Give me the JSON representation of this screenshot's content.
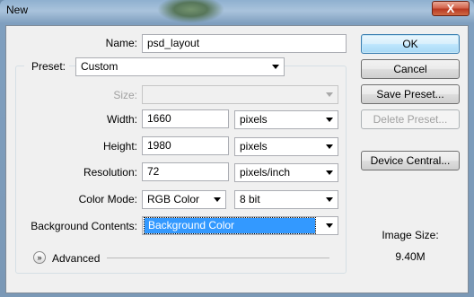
{
  "window": {
    "title": "New",
    "close_glyph": "X"
  },
  "form": {
    "name": {
      "label": "Name:",
      "value": "psd_layout"
    },
    "preset": {
      "label": "Preset:",
      "value": "Custom"
    },
    "size": {
      "label": "Size:",
      "value": ""
    },
    "width": {
      "label": "Width:",
      "value": "1660",
      "unit": "pixels"
    },
    "height": {
      "label": "Height:",
      "value": "1980",
      "unit": "pixels"
    },
    "resolution": {
      "label": "Resolution:",
      "value": "72",
      "unit": "pixels/inch"
    },
    "color_mode": {
      "label": "Color Mode:",
      "value": "RGB Color",
      "depth": "8 bit"
    },
    "background": {
      "label": "Background Contents:",
      "value": "Background Color"
    },
    "advanced": {
      "label": "Advanced"
    }
  },
  "buttons": {
    "ok": "OK",
    "cancel": "Cancel",
    "save_preset": "Save Preset...",
    "delete_preset": "Delete Preset...",
    "device_central": "Device Central..."
  },
  "image_size": {
    "label": "Image Size:",
    "value": "9.40M"
  },
  "icons": {
    "advanced_toggle": "double-chevron-down-icon",
    "dropdown": "triangle-down-icon",
    "close": "close-icon"
  }
}
